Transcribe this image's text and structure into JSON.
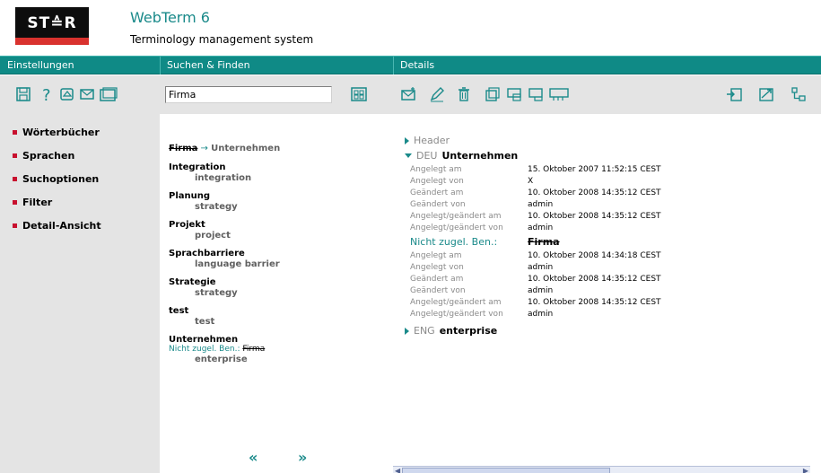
{
  "app": {
    "logo_text": "ST≙R",
    "title": "WebTerm 6",
    "subtitle": "Terminology management system"
  },
  "sections": {
    "settings": "Einstellungen",
    "search": "Suchen & Finden",
    "details": "Details"
  },
  "toolbar": {
    "settings_icons": [
      "save-icon",
      "help-icon",
      "home-icon",
      "mail-icon",
      "window-icon"
    ],
    "search_value": "Firma",
    "search_icon": "dictionary-search-icon",
    "details_icons": [
      "new-entry-icon",
      "edit-icon",
      "delete-icon",
      "copy-icon",
      "print-icon",
      "export-icon",
      "compare-icon"
    ],
    "right_icons": [
      "import-icon",
      "link-icon",
      "tree-icon"
    ]
  },
  "sidebar": {
    "items": [
      {
        "label": "Wörterbücher"
      },
      {
        "label": "Sprachen"
      },
      {
        "label": "Suchoptionen"
      },
      {
        "label": "Filter"
      },
      {
        "label": "Detail-Ansicht"
      }
    ]
  },
  "results": {
    "header_struck": "Firma",
    "header_arrow": "→",
    "header_target": "Unternehmen",
    "entries": [
      {
        "term": "Integration",
        "translation": "integration"
      },
      {
        "term": "Planung",
        "translation": "strategy"
      },
      {
        "term": "Projekt",
        "translation": "project"
      },
      {
        "term": "Sprachbarriere",
        "translation": "language barrier"
      },
      {
        "term": "Strategie",
        "translation": "strategy"
      },
      {
        "term": "test",
        "translation": "test"
      },
      {
        "term": "Unternehmen",
        "note_label": "Nicht zugel. Ben.:",
        "note_value": "Firma",
        "translation": "enterprise"
      }
    ],
    "prev_label": "«",
    "next_label": "»"
  },
  "details": {
    "header_label": "Header",
    "deu": {
      "lang": "DEU",
      "term": "Unternehmen",
      "rows": [
        {
          "label": "Angelegt am",
          "value": "15. Oktober 2007 11:52:15 CEST"
        },
        {
          "label": "Angelegt von",
          "value": "X"
        },
        {
          "label": "Geändert am",
          "value": "10. Oktober 2008 14:35:12 CEST"
        },
        {
          "label": "Geändert von",
          "value": "admin"
        },
        {
          "label": "Angelegt/geändert am",
          "value": "10. Oktober 2008 14:35:12 CEST"
        },
        {
          "label": "Angelegt/geändert von",
          "value": "admin"
        }
      ],
      "sub_label": "Nicht zugel. Ben.:",
      "sub_value": "Firma",
      "sub_rows": [
        {
          "label": "Angelegt am",
          "value": "10. Oktober 2008 14:34:18 CEST"
        },
        {
          "label": "Angelegt von",
          "value": "admin"
        },
        {
          "label": "Geändert am",
          "value": "10. Oktober 2008 14:35:12 CEST"
        },
        {
          "label": "Geändert von",
          "value": "admin"
        },
        {
          "label": "Angelegt/geändert am",
          "value": "10. Oktober 2008 14:35:12 CEST"
        },
        {
          "label": "Angelegt/geändert von",
          "value": "admin"
        }
      ]
    },
    "eng": {
      "lang": "ENG",
      "term": "enterprise"
    }
  },
  "colors": {
    "teal": "#0f8a86",
    "accent_text": "#1a8a8a",
    "bullet_red": "#c8102e",
    "panel_grey": "#e4e4e4"
  }
}
